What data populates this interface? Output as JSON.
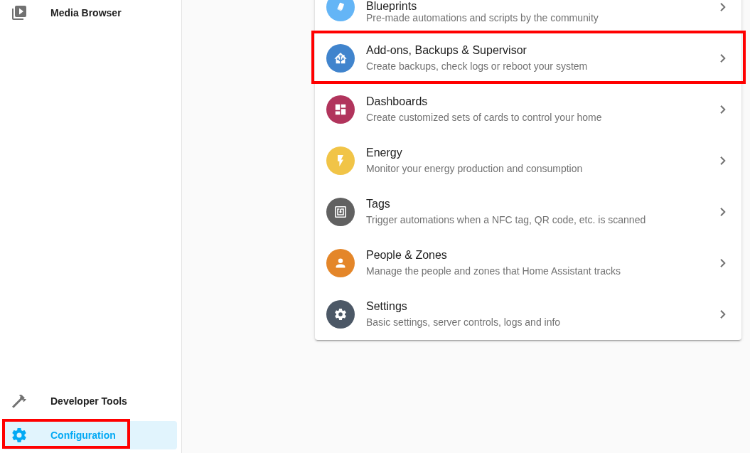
{
  "sidebar": {
    "top_items": [
      {
        "label": "Media Browser",
        "kind": "media",
        "selected": false,
        "highlighted": false
      }
    ],
    "bottom_items": [
      {
        "label": "Developer Tools",
        "kind": "hammer",
        "selected": false,
        "highlighted": false
      },
      {
        "label": "Configuration",
        "kind": "gear",
        "selected": true,
        "highlighted": true
      }
    ]
  },
  "config_list": {
    "items": [
      {
        "title": "Blueprints",
        "description": "Pre-made automations and scripts by the community",
        "kind": "papers",
        "color": "#64b5f6",
        "highlighted": false
      },
      {
        "title": "Add-ons, Backups & Supervisor",
        "description": "Create backups, check logs or reboot your system",
        "kind": "house",
        "color": "#4084cd",
        "highlighted": true
      },
      {
        "title": "Dashboards",
        "description": "Create customized sets of cards to control your home",
        "kind": "dashboard",
        "color": "#b1345c",
        "highlighted": false
      },
      {
        "title": "Energy",
        "description": "Monitor your energy production and consumption",
        "kind": "lightning",
        "color": "#f1c447",
        "highlighted": false
      },
      {
        "title": "Tags",
        "description": "Trigger automations when a NFC tag, QR code, etc. is scanned",
        "kind": "tag",
        "color": "#616161",
        "highlighted": false
      },
      {
        "title": "People & Zones",
        "description": "Manage the people and zones that Home Assistant tracks",
        "kind": "person",
        "color": "#e48629",
        "highlighted": false
      },
      {
        "title": "Settings",
        "description": "Basic settings, server controls, logs and info",
        "kind": "gear",
        "color": "#4c5866",
        "highlighted": false
      }
    ]
  }
}
